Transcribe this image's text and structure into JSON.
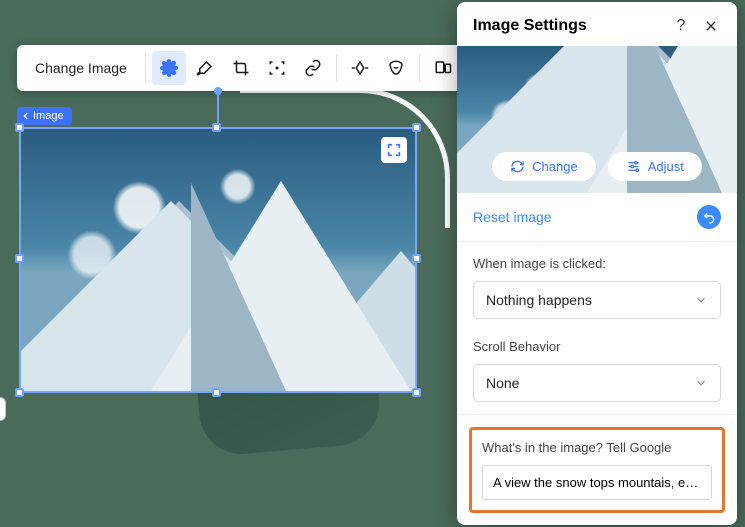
{
  "toolbar": {
    "change_label": "Change Image",
    "icons": {
      "gear": "gear-icon",
      "brush": "brush-icon",
      "crop": "crop-icon",
      "focus": "focus-icon",
      "link": "link-icon",
      "animate": "animate-icon",
      "mask": "mask-icon",
      "layout": "layout-icon"
    }
  },
  "chip": {
    "label": "Image"
  },
  "panel": {
    "title": "Image Settings",
    "change_btn": "Change",
    "adjust_btn": "Adjust",
    "reset_label": "Reset image",
    "click_section": {
      "label": "When image is clicked:",
      "value": "Nothing happens"
    },
    "scroll_section": {
      "label": "Scroll Behavior",
      "value": "None"
    },
    "alt_section": {
      "label": "What's in the image? Tell Google",
      "value": "A view the snow tops mountais, ever…"
    }
  }
}
